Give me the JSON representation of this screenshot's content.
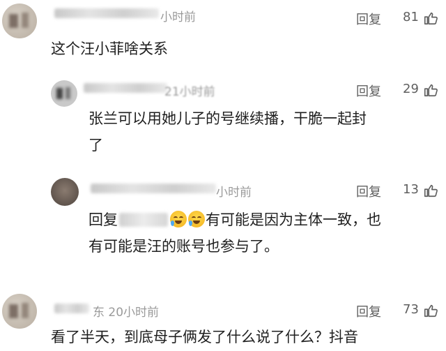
{
  "comments": [
    {
      "time": "小时前",
      "reply_label": "回复",
      "likes": "81",
      "text_lines": [
        "这个汪小菲啥关系"
      ]
    },
    {
      "time": "21小时前",
      "reply_label": "回复",
      "likes": "29",
      "text_lines": [
        "张兰可以用她儿子的号继续播，干脆一起封",
        "了"
      ]
    },
    {
      "time": "小时前",
      "reply_label": "回复",
      "likes": "13",
      "reply_prefix": "回复",
      "text_line1_rest": "有可能是因为主体一致，也",
      "text_line2": "有可能是汪的账号也参与了。"
    },
    {
      "time": "东 20小时前",
      "reply_label": "回复",
      "likes": "73",
      "text_lines": [
        "看了半天，到底母子俩发了什么说了什么？抖音"
      ]
    }
  ],
  "icons": {
    "like": "thumbs-up-icon",
    "emoji": "laughing-crying-emoji"
  },
  "colors": {
    "text": "#1f1f1f",
    "meta": "#9a9a9a",
    "action": "#5f5f5f"
  }
}
